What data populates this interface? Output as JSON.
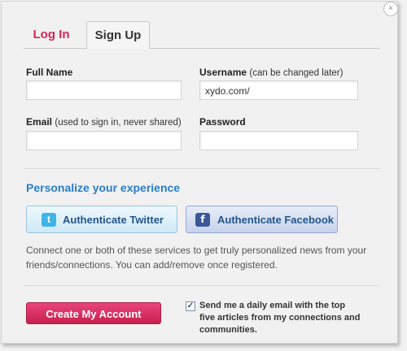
{
  "tabs": {
    "login": "Log In",
    "signup": "Sign Up"
  },
  "close_glyph": "×",
  "form": {
    "full_name": {
      "label": "Full Name",
      "value": ""
    },
    "username": {
      "label": "Username",
      "hint": "(can be changed later)",
      "value": "xydo.com/"
    },
    "email": {
      "label": "Email",
      "hint": "(used to sign in, never shared)",
      "value": ""
    },
    "password": {
      "label": "Password",
      "value": ""
    }
  },
  "personalize": {
    "title": "Personalize your experience",
    "twitter": {
      "label": "Authenticate Twitter",
      "icon": "twitter-icon",
      "glyph": "t",
      "color": "#3fb4e6"
    },
    "facebook": {
      "label": "Authenticate Facebook",
      "icon": "facebook-icon",
      "glyph": "f",
      "color": "#3b5998"
    },
    "description": "Connect one or both of these services to get truly personalized news from your friends/connections. You can add/remove once registered."
  },
  "footer": {
    "create_label": "Create My Account",
    "newsletter": {
      "checked": true,
      "check_glyph": "✓",
      "label": "Send me a daily email with the top five articles from my connections and communities."
    }
  },
  "colors": {
    "accent_pink": "#d6265a",
    "link_blue": "#2a7dc8",
    "button_pink": "#c8204f"
  }
}
